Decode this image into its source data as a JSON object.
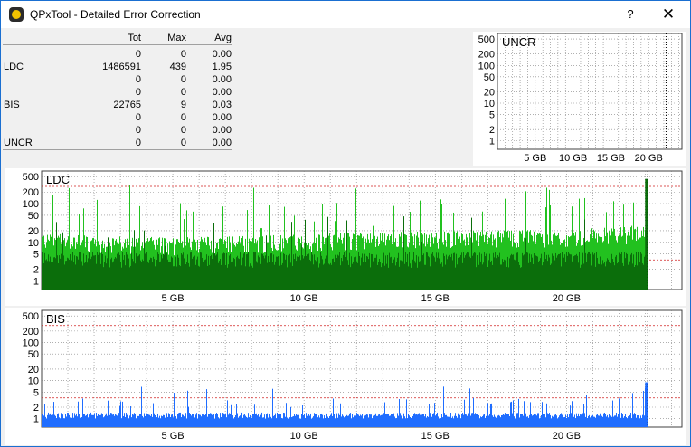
{
  "window": {
    "title": "QPxTool - Detailed Error Correction",
    "help_label": "?",
    "close_label": "✕"
  },
  "stats": {
    "headers": [
      "Tot",
      "Max",
      "Avg"
    ],
    "rows": [
      {
        "label": "",
        "tot": "0",
        "max": "0",
        "avg": "0.00"
      },
      {
        "label": "LDC",
        "tot": "1486591",
        "max": "439",
        "avg": "1.95"
      },
      {
        "label": "",
        "tot": "0",
        "max": "0",
        "avg": "0.00"
      },
      {
        "label": "",
        "tot": "0",
        "max": "0",
        "avg": "0.00"
      },
      {
        "label": "BIS",
        "tot": "22765",
        "max": "9",
        "avg": "0.03"
      },
      {
        "label": "",
        "tot": "0",
        "max": "0",
        "avg": "0.00"
      },
      {
        "label": "",
        "tot": "0",
        "max": "0",
        "avg": "0.00"
      },
      {
        "label": "UNCR",
        "tot": "0",
        "max": "0",
        "avg": "0.00"
      }
    ]
  },
  "colors": {
    "ldc_light": "#22c11f",
    "ldc_dark": "#0b6e0b",
    "bis": "#1f6dff",
    "limit_red": "#d02020",
    "grid": "#808080",
    "end_marker": "#000000"
  },
  "chart_data": [
    {
      "type": "bar",
      "title": "UNCR",
      "scale": "log",
      "grid": true,
      "y_ticks": [
        500,
        200,
        100,
        50,
        20,
        10,
        5,
        2,
        1
      ],
      "x_ticks": [
        "5 GB",
        "10 GB",
        "15 GB",
        "20 GB"
      ],
      "x_tick_values_gb": [
        5,
        10,
        15,
        20
      ],
      "xlim_gb": [
        0,
        24.4
      ],
      "ylim": [
        0.6,
        700
      ],
      "disc_end_gb": 22.3,
      "values": []
    },
    {
      "type": "bar",
      "title": "LDC",
      "scale": "log",
      "grid": true,
      "y_ticks": [
        500,
        200,
        100,
        50,
        20,
        10,
        5,
        2,
        1
      ],
      "x_ticks": [
        "5 GB",
        "10 GB",
        "15 GB",
        "20 GB"
      ],
      "x_tick_values_gb": [
        5,
        10,
        15,
        20
      ],
      "xlim_gb": [
        0,
        24.4
      ],
      "ylim": [
        0.6,
        700
      ],
      "disc_end_gb": 23.1,
      "limit_lines": [
        280,
        3.5
      ],
      "series": [
        {
          "name": "",
          "envelope": [
            [
              0,
              12
            ],
            [
              2,
              10
            ],
            [
              5,
              9
            ],
            [
              8,
              10
            ],
            [
              10,
              11
            ],
            [
              12,
              12
            ],
            [
              15,
              13
            ],
            [
              18,
              14
            ],
            [
              20,
              15
            ],
            [
              22,
              17
            ],
            [
              23.1,
              20
            ]
          ],
          "max": 439
        }
      ]
    },
    {
      "type": "bar",
      "title": "BIS",
      "scale": "log",
      "grid": true,
      "y_ticks": [
        500,
        200,
        100,
        50,
        20,
        10,
        5,
        2,
        1
      ],
      "x_ticks": [
        "5 GB",
        "10 GB",
        "15 GB",
        "20 GB"
      ],
      "x_tick_values_gb": [
        5,
        10,
        15,
        20
      ],
      "xlim_gb": [
        0,
        24.4
      ],
      "ylim": [
        0.6,
        700
      ],
      "disc_end_gb": 23.1,
      "limit_lines": [
        280,
        3.5
      ],
      "series": [
        {
          "name": "",
          "max": 9
        }
      ]
    }
  ]
}
